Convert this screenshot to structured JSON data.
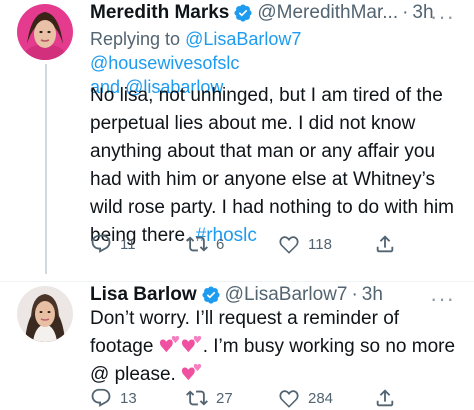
{
  "tweets": [
    {
      "name": "Meredith Marks",
      "handle": "@MeredithMar...",
      "time": "3h",
      "replying_prefix": "Replying to",
      "replying_to_1": "@LisaBarlow7",
      "replying_to_2": "@housewivesofslc",
      "replying_and": "and",
      "replying_to_3": "@lisabarlow",
      "lines": [
        "No lisa, not unhinged, but I am tired of the",
        "perpetual lies about me. I did not know",
        "anything about that man or any affair you",
        "had with him or anyone else at Whitney’s",
        "wild rose party. I had nothing to do with him",
        "being there."
      ],
      "hashtag": "#rhoslc",
      "replies": "11",
      "retweets": "6",
      "likes": "118",
      "avatar_bg": "#e43b8f"
    },
    {
      "name": "Lisa Barlow",
      "handle": "@LisaBarlow7",
      "time": "3h",
      "line1": "Don’t worry. I’ll request a reminder of",
      "line2_a": "footage",
      "line2_b": ". I’m busy working so no more",
      "line3": "@ please.",
      "replies": "13",
      "retweets": "27",
      "likes": "284",
      "avatar_bg": "#e9e4e2"
    }
  ],
  "more_glyph": "···",
  "colors": {
    "verified": "#1d9bf0",
    "link": "#1d9bf0",
    "muted": "#536471",
    "emoji_pink": "#f050a0"
  }
}
